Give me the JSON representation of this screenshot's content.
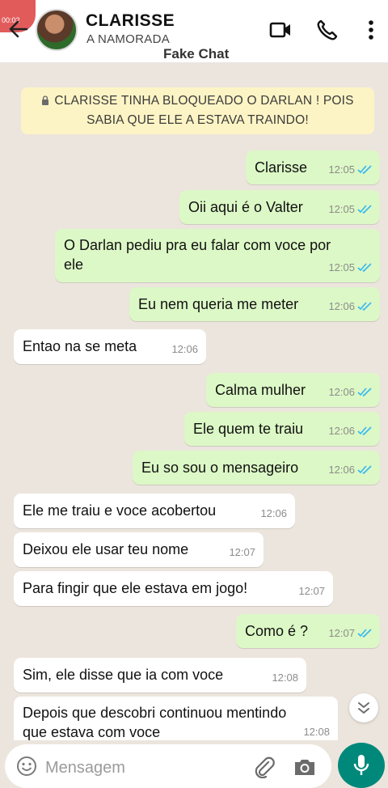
{
  "header": {
    "rec_time": "00:02",
    "contact_name": "CLARISSE",
    "contact_status": "A NAMORADA",
    "watermark": "Fake Chat"
  },
  "notice": {
    "line1": "CLARISSE TINHA BLOQUEADO O DARLAN ! POIS",
    "line2": "SABIA QUE ELE A ESTAVA TRAINDO!"
  },
  "messages": [
    {
      "dir": "out",
      "text": "Clarisse",
      "time": "12:05"
    },
    {
      "dir": "out",
      "text": "Oii aqui é o Valter",
      "time": "12:05"
    },
    {
      "dir": "out",
      "line1": "O Darlan pediu pra eu falar com voce por",
      "line2": "ele",
      "time": "12:05"
    },
    {
      "dir": "out",
      "text": "Eu nem queria me meter",
      "time": "12:06"
    },
    {
      "dir": "in",
      "text": "Entao na se meta",
      "time": "12:06"
    },
    {
      "dir": "out",
      "text": "Calma mulher",
      "time": "12:06"
    },
    {
      "dir": "out",
      "text": "Ele quem te traiu",
      "time": "12:06"
    },
    {
      "dir": "out",
      "text": "Eu so sou o mensageiro",
      "time": "12:06"
    },
    {
      "dir": "in",
      "text": "Ele me traiu e voce acobertou",
      "time": "12:06"
    },
    {
      "dir": "in",
      "text": "Deixou ele usar teu nome",
      "time": "12:07"
    },
    {
      "dir": "in",
      "text": "Para fingir que ele estava em jogo!",
      "time": "12:07"
    },
    {
      "dir": "out",
      "text": "Como é ?",
      "time": "12:07"
    },
    {
      "dir": "in",
      "text": "Sim, ele disse que ia com voce",
      "time": "12:08"
    },
    {
      "dir": "in",
      "line1": "Depois que descobri continuou mentindo",
      "line2": "que estava com voce",
      "time": "12:08"
    }
  ],
  "input": {
    "placeholder": "Mensagem"
  },
  "colors": {
    "outgoing_bubble": "#dcf8c6",
    "incoming_bubble": "#ffffff",
    "chat_background": "#ece5dd",
    "accent": "#00897b",
    "read_ticks": "#34b7f1"
  }
}
